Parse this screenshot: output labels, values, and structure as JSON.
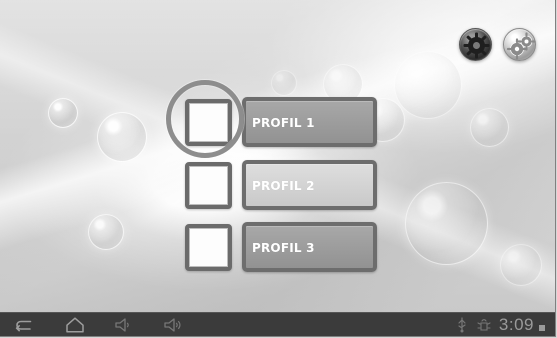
{
  "profiles": [
    {
      "label": "PROFIL 1"
    },
    {
      "label": "PROFIL 2"
    },
    {
      "label": "PROFIL 3"
    }
  ],
  "status_bar": {
    "time": "3:09"
  },
  "icons": {
    "profile_settings": "gear-icon",
    "system_settings": "settings-gears-icon",
    "back": "back-arrow-icon",
    "home": "home-icon",
    "volume_down": "volume-down-icon",
    "volume_up": "volume-up-icon",
    "usb": "usb-icon",
    "debug": "android-debug-icon",
    "battery": "battery-icon"
  },
  "colors": {
    "frame_gray": "#6d6d6d",
    "selection_ring": "#8d8d8d",
    "system_bar": "#3b3b3b"
  }
}
